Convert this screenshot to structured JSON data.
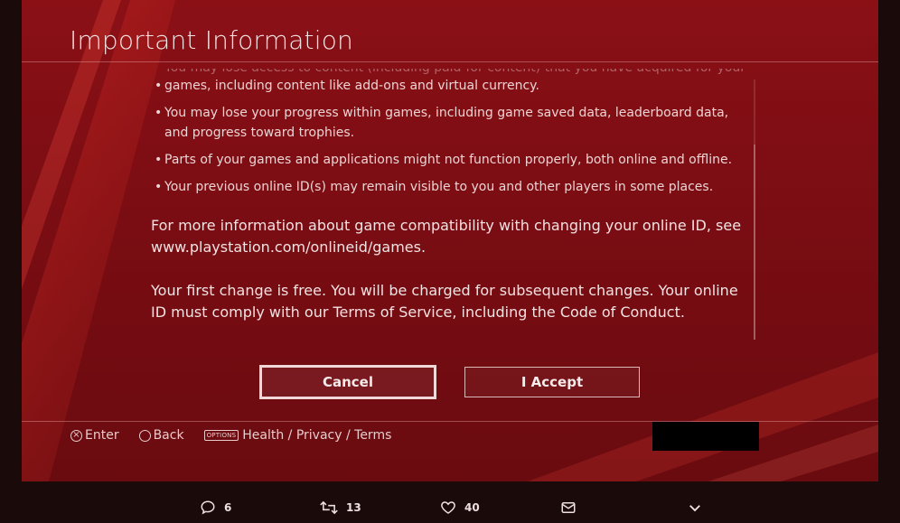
{
  "dialog": {
    "title": "Important Information",
    "bullets": [
      "games, including content like add-ons and virtual currency.",
      "You may lose your progress within games, including game saved data, leaderboard data, and progress toward trophies.",
      "Parts of your games and applications might not function properly, both online and offline.",
      "Your previous online ID(s) may remain visible to you and other players in some places."
    ],
    "partial_top_line": "You may lose access to content (including paid-for content) that you have acquired for your",
    "para_info": "For more information about game compatibility with changing your online ID, see www.playstation.com/onlineid/games.",
    "para_free": "Your first change is free. You will be charged for subsequent changes. Your online ID must comply with our Terms of Service, including the Code of Conduct.",
    "cancel_label": "Cancel",
    "accept_label": "I Accept"
  },
  "footer": {
    "enter_label": "Enter",
    "back_label": "Back",
    "options_badge": "OPTIONS",
    "options_label": "Health / Privacy / Terms"
  },
  "tweet_actions": {
    "replies": "6",
    "retweets": "13",
    "likes": "40"
  },
  "colors": {
    "background": "#7a0d13",
    "text": "#f2e2e2"
  }
}
